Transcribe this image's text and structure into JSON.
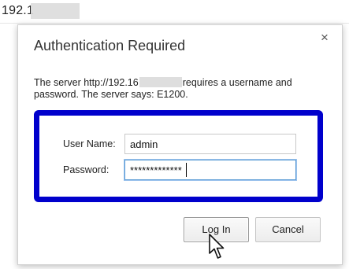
{
  "browser": {
    "address_visible": "192.1"
  },
  "dialog": {
    "title": "Authentication Required",
    "close_glyph": "×",
    "message_part1": "The server http://192.16",
    "message_part2": "requires a username and password. The server says: E1200."
  },
  "form": {
    "username_label": "User Name:",
    "username_value": "admin",
    "password_label": "Password:",
    "password_value": "*************"
  },
  "buttons": {
    "login_label": "Log In",
    "cancel_label": "Cancel"
  },
  "colors": {
    "highlight_frame": "#0000cc",
    "focus_border": "#5b9bd5"
  },
  "icons": {
    "close": "close-icon",
    "cursor": "mouse-pointer-icon"
  }
}
